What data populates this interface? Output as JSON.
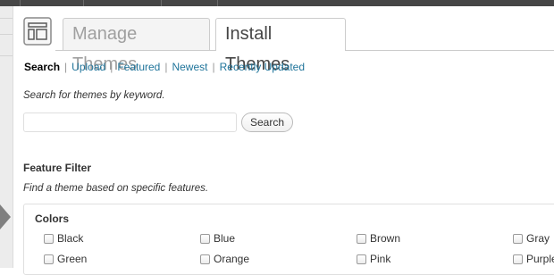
{
  "tabs": [
    {
      "label": "Manage Themes",
      "active": false
    },
    {
      "label": "Install Themes",
      "active": true
    }
  ],
  "subnav": {
    "items": [
      {
        "label": "Search",
        "current": true
      },
      {
        "label": "Upload",
        "current": false
      },
      {
        "label": "Featured",
        "current": false
      },
      {
        "label": "Newest",
        "current": false
      },
      {
        "label": "Recently Updated",
        "current": false
      }
    ],
    "separator": "|"
  },
  "search": {
    "hint": "Search for themes by keyword.",
    "value": "",
    "placeholder": "",
    "button_label": "Search"
  },
  "feature_filter": {
    "title": "Feature Filter",
    "description": "Find a theme based on specific features.",
    "colors_group": {
      "title": "Colors",
      "options": [
        "Black",
        "Blue",
        "Brown",
        "Gray",
        "Green",
        "Orange",
        "Pink",
        "Purple"
      ]
    }
  },
  "colors": {
    "link": "#21759b",
    "admin_bar": "#464646",
    "inactive_tab_text": "#a0a0a0"
  },
  "icons": {
    "header": "themes-layout-icon",
    "pointer": "menu-pointer-arrow-icon"
  }
}
